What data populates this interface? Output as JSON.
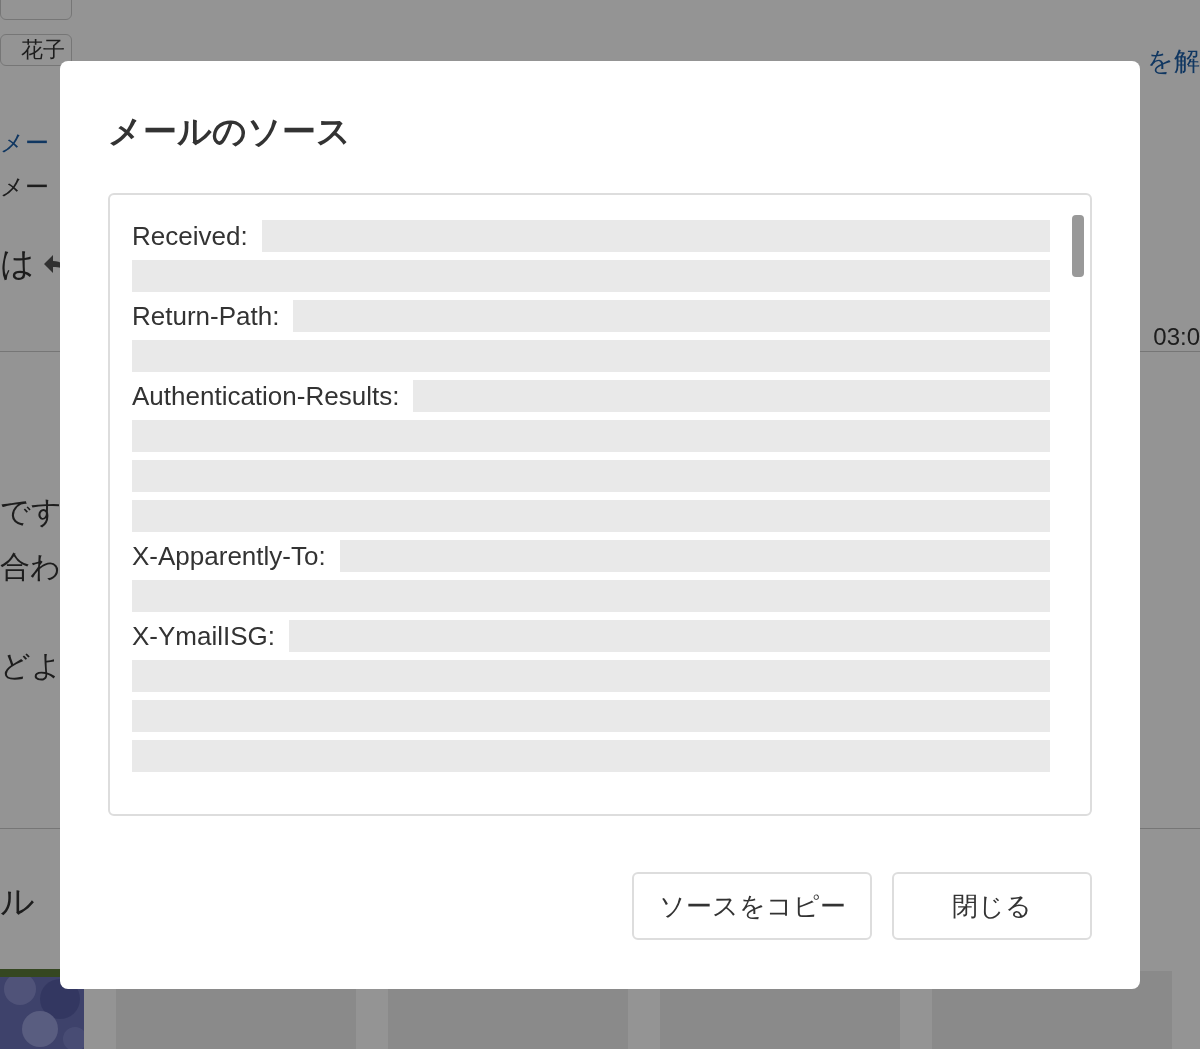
{
  "background": {
    "recipients": [
      "花子"
    ],
    "header_links": [
      "を解"
    ],
    "folder_link": "メー",
    "folder_label": "メー",
    "subject_fragment": "は",
    "time": "03:0",
    "body_fragments": [
      "です",
      "合わ",
      "どよ"
    ],
    "section_fragment": "ル"
  },
  "dialog": {
    "title": "メールのソース",
    "source_lines": [
      {
        "kind": "header",
        "label": "Received:"
      },
      {
        "kind": "continuation"
      },
      {
        "kind": "header",
        "label": "Return-Path:"
      },
      {
        "kind": "continuation"
      },
      {
        "kind": "header",
        "label": "Authentication-Results:"
      },
      {
        "kind": "continuation"
      },
      {
        "kind": "continuation"
      },
      {
        "kind": "continuation"
      },
      {
        "kind": "header",
        "label": "X-Apparently-To:"
      },
      {
        "kind": "continuation"
      },
      {
        "kind": "header",
        "label": "X-YmailISG:"
      },
      {
        "kind": "continuation"
      },
      {
        "kind": "continuation"
      },
      {
        "kind": "continuation"
      }
    ],
    "buttons": [
      "ソースをコピー",
      "閉じる"
    ]
  }
}
